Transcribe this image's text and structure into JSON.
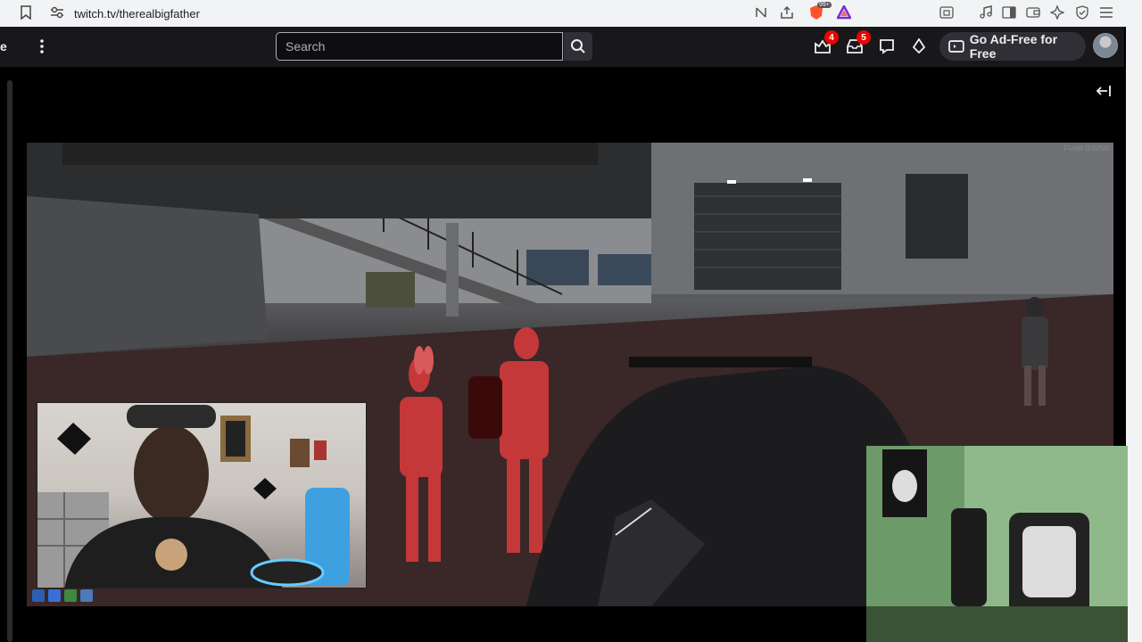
{
  "browser": {
    "url": "twitch.tv/therealbigfather",
    "icons": [
      "bookmark-icon",
      "site-info-icon",
      "reader-off-icon",
      "share-icon",
      "brave-shield-icon",
      "brave-rewards-icon",
      "tab-icon",
      "media-icon",
      "sidebar-icon",
      "wallet-icon",
      "leo-icon",
      "vpn-icon",
      "menu-icon"
    ],
    "shield_badge": "99+"
  },
  "twitch_nav": {
    "brand_fragment": "e",
    "search_placeholder": "Search",
    "prime_count": "4",
    "inbox_count": "5",
    "ad_free_label": "Go Ad-Free for Free"
  },
  "stream": {
    "watermark": "FiveM (b3258)"
  },
  "colors": {
    "twitch_bg": "#18181b",
    "badge": "#eb0400",
    "browser_bar": "#f1f3f4"
  }
}
